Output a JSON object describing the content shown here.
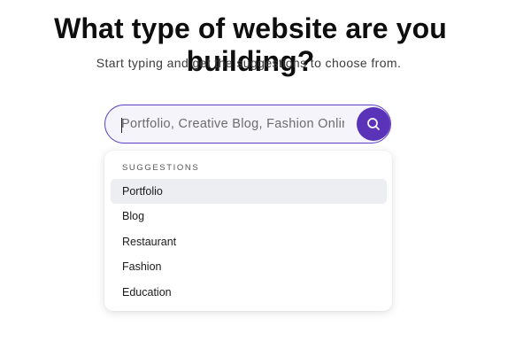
{
  "heading": {
    "title": "What type of website are you building?",
    "subtitle": "Start typing and get the suggestions to choose from."
  },
  "search": {
    "placeholder": "Portfolio, Creative Blog, Fashion Online Store",
    "value": "",
    "button_icon": "search-icon",
    "accent_color": "#5a33b8"
  },
  "suggestions": {
    "header": "SUGGESTIONS",
    "items": [
      {
        "label": "Portfolio",
        "active": true
      },
      {
        "label": "Blog",
        "active": false
      },
      {
        "label": "Restaurant",
        "active": false
      },
      {
        "label": "Fashion",
        "active": false
      },
      {
        "label": "Education",
        "active": false
      }
    ]
  }
}
